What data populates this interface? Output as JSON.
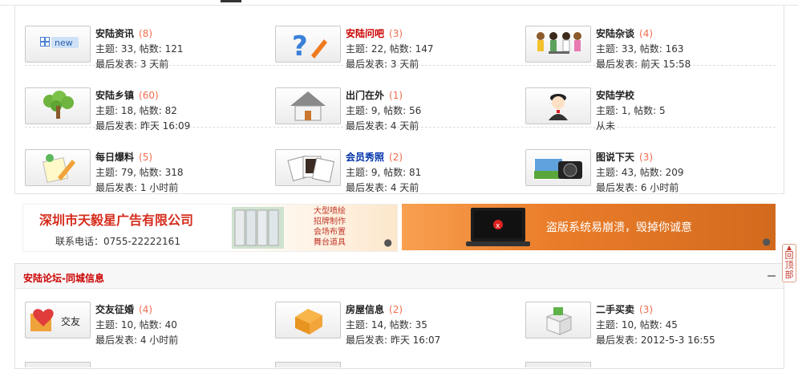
{
  "forums_top": [
    [
      {
        "icon": "new-icon",
        "title": "安陆资讯",
        "count": "(8)",
        "topics": "主题: 33, 帖数: 121",
        "last": "最后发表: 3 天前",
        "color": "normal"
      },
      {
        "icon": "question-mark-icon",
        "title": "安陆问吧",
        "count": "(3)",
        "topics": "主题: 22, 帖数: 147",
        "last": "最后发表: 3 天前",
        "color": "red"
      },
      {
        "icon": "people-chatting-icon",
        "title": "安陆杂谈",
        "count": "(4)",
        "topics": "主题: 33, 帖数: 163",
        "last": "最后发表: 前天 15:58",
        "color": "normal"
      }
    ],
    [
      {
        "icon": "tree-icon",
        "title": "安陆乡镇",
        "count": "(60)",
        "topics": "主题: 18, 帖数: 82",
        "last": "最后发表: 昨天 16:09",
        "color": "normal"
      },
      {
        "icon": "house-icon",
        "title": "出门在外",
        "count": "(1)",
        "topics": "主题: 9, 帖数: 56",
        "last": "最后发表: 4 天前",
        "color": "normal"
      },
      {
        "icon": "student-icon",
        "title": "安陆学校",
        "count": "",
        "topics": "主题: 1, 帖数: 5",
        "last": "从未",
        "color": "normal"
      }
    ],
    [
      {
        "icon": "note-pencil-icon",
        "title": "每日爆料",
        "count": "(5)",
        "topics": "主题: 79, 帖数: 318",
        "last": "最后发表: 1 小时前",
        "color": "normal"
      },
      {
        "icon": "photos-icon",
        "title": "会员秀照",
        "count": "(2)",
        "topics": "主题: 9, 帖数: 81",
        "last": "最后发表: 4 天前",
        "color": "blue"
      },
      {
        "icon": "camera-icon",
        "title": "图说下天",
        "count": "(3)",
        "topics": "主题: 43, 帖数: 209",
        "last": "最后发表: 6 小时前",
        "color": "normal"
      }
    ]
  ],
  "ads": {
    "left": {
      "title": "深圳市天毅星广告有限公司",
      "phone": "联系电话：0755-22222161",
      "services": [
        "大型喷绘",
        "招牌制作",
        "会场布置",
        "舞台道具"
      ]
    },
    "right": {
      "text": "盗版系统易崩溃，毁掉你诚意"
    }
  },
  "section2": {
    "title": "安陆论坛-同城信息",
    "forums": [
      {
        "icon": "gift-heart-icon",
        "title": "交友征婚",
        "count": "(4)",
        "topics": "主题: 10, 帖数: 40",
        "last": "最后发表: 4 小时前",
        "color": "normal",
        "icon_text": "交友"
      },
      {
        "icon": "building-icon",
        "title": "房屋信息",
        "count": "(2)",
        "topics": "主题: 14, 帖数: 35",
        "last": "最后发表: 昨天 16:07",
        "color": "normal"
      },
      {
        "icon": "box-icon",
        "title": "二手买卖",
        "count": "(3)",
        "topics": "主题: 10, 帖数: 45",
        "last": "最后发表: 2012-5-3 16:55",
        "color": "normal"
      }
    ]
  },
  "back_to_top": "回顶部",
  "new_icon_text": "new"
}
